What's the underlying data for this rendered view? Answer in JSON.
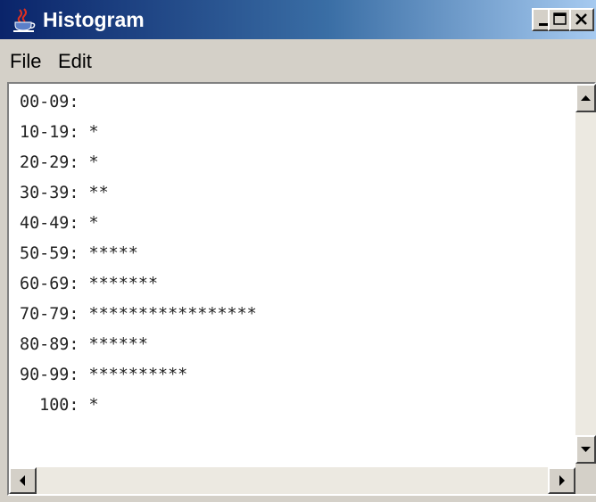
{
  "window": {
    "title": "Histogram",
    "title_icon": "java-cup-icon",
    "controls": [
      "minimize-icon",
      "maximize-icon",
      "close-icon"
    ]
  },
  "menu": {
    "items": [
      {
        "label": "File"
      },
      {
        "label": "Edit"
      }
    ]
  },
  "histogram": {
    "lines": [
      {
        "range": "00-09:",
        "stars": ""
      },
      {
        "range": "10-19:",
        "stars": "*"
      },
      {
        "range": "20-29:",
        "stars": "*"
      },
      {
        "range": "30-39:",
        "stars": "**"
      },
      {
        "range": "40-49:",
        "stars": "*"
      },
      {
        "range": "50-59:",
        "stars": "*****"
      },
      {
        "range": "60-69:",
        "stars": "*******"
      },
      {
        "range": "70-79:",
        "stars": "*****************"
      },
      {
        "range": "80-89:",
        "stars": "******"
      },
      {
        "range": "90-99:",
        "stars": "**********"
      },
      {
        "range": "  100:",
        "stars": "*"
      }
    ]
  },
  "scrollbars": {
    "vertical": [
      "scroll-up-icon",
      "scroll-down-icon"
    ],
    "horizontal": [
      "scroll-left-icon",
      "scroll-right-icon"
    ]
  },
  "colors": {
    "titlebar_start": "#0a246a",
    "titlebar_end": "#a6caf0",
    "face": "#d4d0c8"
  }
}
